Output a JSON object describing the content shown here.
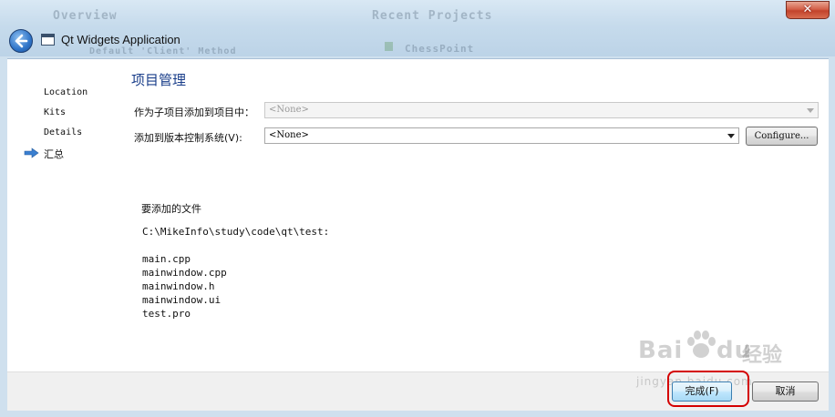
{
  "window": {
    "title": "Qt Widgets Application",
    "background_text": [
      "Overview",
      "Recent Projects",
      "Default 'Client' Method",
      "ChessPoint"
    ],
    "close_label": "✕"
  },
  "nav": {
    "items": [
      {
        "label": "Location"
      },
      {
        "label": "Kits"
      },
      {
        "label": "Details"
      },
      {
        "label": "汇总"
      }
    ],
    "current_index": 3
  },
  "page": {
    "title": "项目管理",
    "subproject_label": "作为子项目添加到项目中：",
    "subproject_value": "<None>",
    "vcs_label": "添加到版本控制系统(V):",
    "vcs_value": "<None>",
    "configure_label": "Configure...",
    "files_title": "要添加的文件",
    "path": "C:\\MikeInfo\\study\\code\\qt\\test:",
    "files": [
      "main.cpp",
      "mainwindow.cpp",
      "mainwindow.h",
      "mainwindow.ui",
      "test.pro"
    ]
  },
  "footer": {
    "finish_label": "完成(F)",
    "cancel_label": "取消"
  },
  "watermark": {
    "brand": "Bai",
    "brand_tail": "du",
    "brand_cn": "经验",
    "url": "jingyan.baidu.com"
  },
  "colors": {
    "accent": "#1a3e8a",
    "highlight": "#d40000",
    "nav_arrow": "#3a7fd0"
  }
}
